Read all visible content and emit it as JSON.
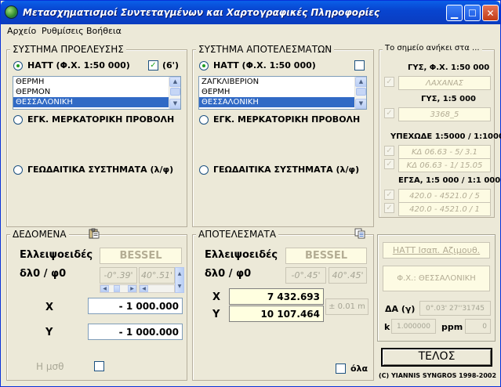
{
  "window": {
    "title": "Μετασχηματισμοί Συντεταγμένων και Χαρτογραφικές Πληροφορίες"
  },
  "menu": {
    "file": "Αρχείο",
    "settings": "Ρυθμίσεις",
    "help": "Βοήθεια"
  },
  "source_system": {
    "legend": "ΣΥΣΤΗΜΑ ΠΡΟΕΛΕΥΣΗΣ",
    "hatt_label": "ΗΑΤΤ (Φ.Χ. 1:50 000)",
    "six_check_label": "(6')",
    "sheets": [
      "ΘΕΡΜΗ",
      "ΘΕΡΜΟΝ",
      "ΘΕΣΣΑΛΟΝΙΚΗ"
    ],
    "selected_sheet": "ΘΕΣΣΑΛΟΝΙΚΗ",
    "mercator_label": "ΕΓΚ. ΜΕΡΚΑΤΟΡΙΚΗ ΠΡΟΒΟΛΗ",
    "geodetic_label": "ΓΕΩΔΑΙΤΙΚΑ ΣΥΣΤΗΜΑΤΑ (λ/φ)"
  },
  "result_system": {
    "legend": "ΣΥΣΤΗΜΑ ΑΠΟΤΕΛΕΣΜΑΤΩΝ",
    "hatt_label": "ΗΑΤΤ (Φ.Χ. 1:50 000)",
    "sheets": [
      "ΖΑΓΚΛΙΒΕΡΙΟΝ",
      "ΘΕΡΜΗ",
      "ΘΕΣΣΑΛΟΝΙΚΗ"
    ],
    "selected_sheet": "ΘΕΣΣΑΛΟΝΙΚΗ",
    "mercator_label": "ΕΓΚ. ΜΕΡΚΑΤΟΡΙΚΗ ΠΡΟΒΟΛΗ",
    "geodetic_label": "ΓΕΩΔΑΙΤΙΚΑ ΣΥΣΤΗΜΑΤΑ (λ/φ)"
  },
  "point_belongs": {
    "legend": "Το σημείο ανήκει στα ...",
    "gys_50000_label": "ΓΥΣ, Φ.Χ. 1:50 000",
    "gys_50000_value": "ΛΑΧΑΝΑΣ",
    "gys_5000_label": "ΓΥΣ,  1:5 000",
    "gys_5000_value": "3368_5",
    "ypexode_label": "ΥΠΕΧΩΔΕ 1:5000 / 1:1000",
    "ypexode_value_1": "ΚΔ 06.63 - 5/ 3.1",
    "ypexode_value_2": "ΚΔ 06.63 - 1/ 15.05",
    "egsa_label": "ΕΓΣΑ, 1:5 000 / 1:1 000",
    "egsa_value_1": "420.0 - 4521.0 / 5",
    "egsa_value_2": "420.0 - 4521.0 / 1"
  },
  "data": {
    "legend": "ΔΕΔΟΜΕΝΑ",
    "ellipsoid_label": "Ελλειψοειδές",
    "ellipsoid_value": "BESSEL",
    "dl_dphi_label": "δλ0 / φ0",
    "dl_value": "-0°.39'",
    "dphi_value": "40°.51'",
    "x_label": "X",
    "x_value": "- 1 000.000",
    "y_label": "Y",
    "y_value": "- 1 000.000",
    "h_label": "Η μσθ"
  },
  "results": {
    "legend": "ΑΠΟΤΕΛΕΣΜΑΤΑ",
    "ellipsoid_label": "Ελλειψοειδές",
    "ellipsoid_value": "BESSEL",
    "dl_dphi_label": "δλ0 / φ0",
    "dl_value": "-0°.45'",
    "dphi_value": "40°.45'",
    "x_label": "X",
    "x_value": "7 432.693",
    "y_label": "Y",
    "y_value": "10 107.464",
    "accuracy": "± 0.01 m",
    "all_label": "όλα"
  },
  "info_panel": {
    "projection_title": "ΗΑΤΤ Ισαπ. Αζιμουθ.",
    "sheet_name": "Φ.Χ.: ΘΕΣΣΑΛΟΝΙΚΗ",
    "da_label": "ΔΑ (γ)",
    "da_value": "0°.03' 27''31745",
    "k_label": "k",
    "k_value": "1.000000",
    "ppm_label": "ppm",
    "ppm_value": "0"
  },
  "footer": {
    "telos_label": "ΤΕΛΟΣ",
    "copyright": "(C) YIANNIS SYNGROS 1998-2002"
  },
  "colors": {
    "titlebar": "#0845d0",
    "selection": "#316ac5",
    "window_bg": "#ece9d8",
    "disabled_field": "#fdfbe3",
    "result_field": "#ffffe0"
  }
}
